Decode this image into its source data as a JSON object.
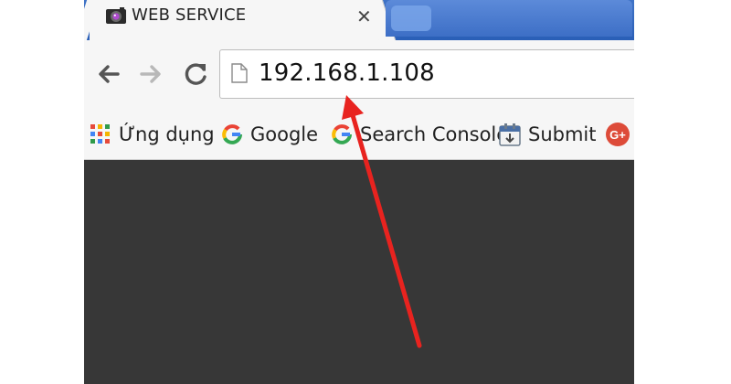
{
  "tabs": {
    "active": {
      "title": "WEB SERVICE",
      "close_glyph": "✕"
    }
  },
  "toolbar": {
    "address": "192.168.1.108"
  },
  "bookmarks": [
    {
      "label": "Ứng dụng",
      "icon": "apps-grid-icon"
    },
    {
      "label": "Google",
      "icon": "google-g-icon"
    },
    {
      "label": "Search Console",
      "icon": "google-g-icon"
    },
    {
      "label": "Submit",
      "icon": "calendar-submit-icon"
    },
    {
      "label": "",
      "icon": "google-plus-icon"
    }
  ],
  "colors": {
    "tabbar": "#2a5fb7",
    "toolbar": "#f6f6f6",
    "content": "#373737",
    "annotation": "#e8231f"
  }
}
